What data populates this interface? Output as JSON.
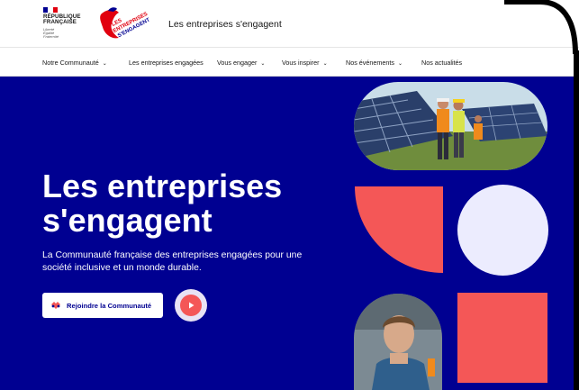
{
  "header": {
    "republic_line1": "RÉPUBLIQUE",
    "republic_line2": "FRANÇAISE",
    "motto": [
      "Liberté",
      "Égalité",
      "Fraternité"
    ],
    "logo_text1": "LES",
    "logo_text2": "ENTREPRISES",
    "logo_text3": "S'ENGAGENT",
    "site_title": "Les entreprises s'engagent"
  },
  "nav": [
    {
      "label": "Notre Communauté",
      "dropdown": true
    },
    {
      "label": "Les entreprises engagées",
      "dropdown": false
    },
    {
      "label": "Vous engager",
      "dropdown": true
    },
    {
      "label": "Vous inspirer",
      "dropdown": true
    },
    {
      "label": "Nos événements",
      "dropdown": true
    },
    {
      "label": "Nos actualités",
      "dropdown": false
    }
  ],
  "hero": {
    "title": "Les entreprises s'engagent",
    "subtitle": "La Communauté française des entreprises engagées pour une société inclusive et un monde durable.",
    "cta_label": "Rejoindre la Communauté",
    "play_icon": "play-icon"
  },
  "colors": {
    "brand_blue": "#000091",
    "accent_red": "#f45757",
    "lavender": "#ececfe",
    "flag_red": "#e1000f"
  }
}
